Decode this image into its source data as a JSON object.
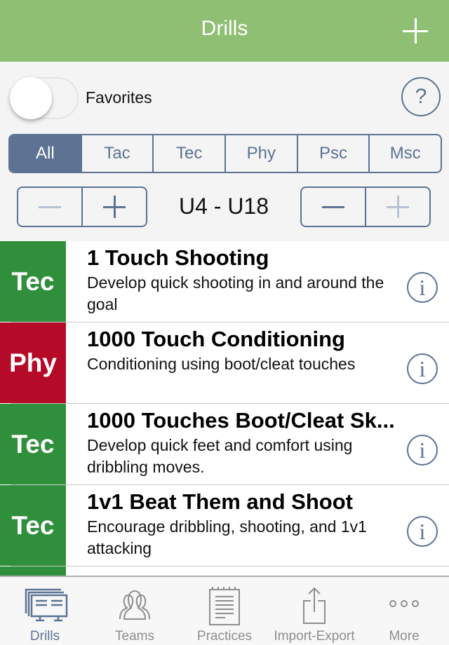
{
  "navbar": {
    "title": "Drills",
    "add_icon": "plus-icon"
  },
  "favorites": {
    "label": "Favorites",
    "enabled": false,
    "help_label": "?"
  },
  "filters": {
    "categories": [
      {
        "label": "All",
        "active": true
      },
      {
        "label": "Tac",
        "active": false
      },
      {
        "label": "Tec",
        "active": false
      },
      {
        "label": "Phy",
        "active": false
      },
      {
        "label": "Psc",
        "active": false
      },
      {
        "label": "Msc",
        "active": false
      }
    ],
    "age_range": "U4 - U18",
    "min_stepper": {
      "minus_enabled": false,
      "plus_enabled": true
    },
    "max_stepper": {
      "minus_enabled": true,
      "plus_enabled": false
    }
  },
  "colors": {
    "tec": "#2f8f3b",
    "phy": "#b50b28",
    "accent": "#5c7394",
    "header": "#8fbf72"
  },
  "drills": [
    {
      "category": "Tec",
      "color": "#2f8f3b",
      "title": "1 Touch Shooting",
      "description": "Develop quick shooting in and around the goal",
      "info": "i"
    },
    {
      "category": "Phy",
      "color": "#b50b28",
      "title": "1000 Touch Conditioning",
      "description": "Conditioning using boot/cleat touches",
      "info": "i"
    },
    {
      "category": "Tec",
      "color": "#2f8f3b",
      "title": "1000 Touches Boot/Cleat Sk...",
      "description": "Develop quick feet and comfort using dribbling moves.",
      "info": "i"
    },
    {
      "category": "Tec",
      "color": "#2f8f3b",
      "title": "1v1 Beat Them and Shoot",
      "description": "Encourage dribbling, shooting, and 1v1 attacking",
      "info": "i"
    },
    {
      "category": "",
      "color": "#2f8f3b",
      "title": "",
      "description": "",
      "info": ""
    }
  ],
  "tabbar": [
    {
      "label": "Drills",
      "icon": "drill-cards-icon",
      "active": true
    },
    {
      "label": "Teams",
      "icon": "people-icon",
      "active": false
    },
    {
      "label": "Practices",
      "icon": "notepad-icon",
      "active": false
    },
    {
      "label": "Import-Export",
      "icon": "share-icon",
      "active": false
    },
    {
      "label": "More",
      "icon": "more-dots-icon",
      "active": false
    }
  ]
}
